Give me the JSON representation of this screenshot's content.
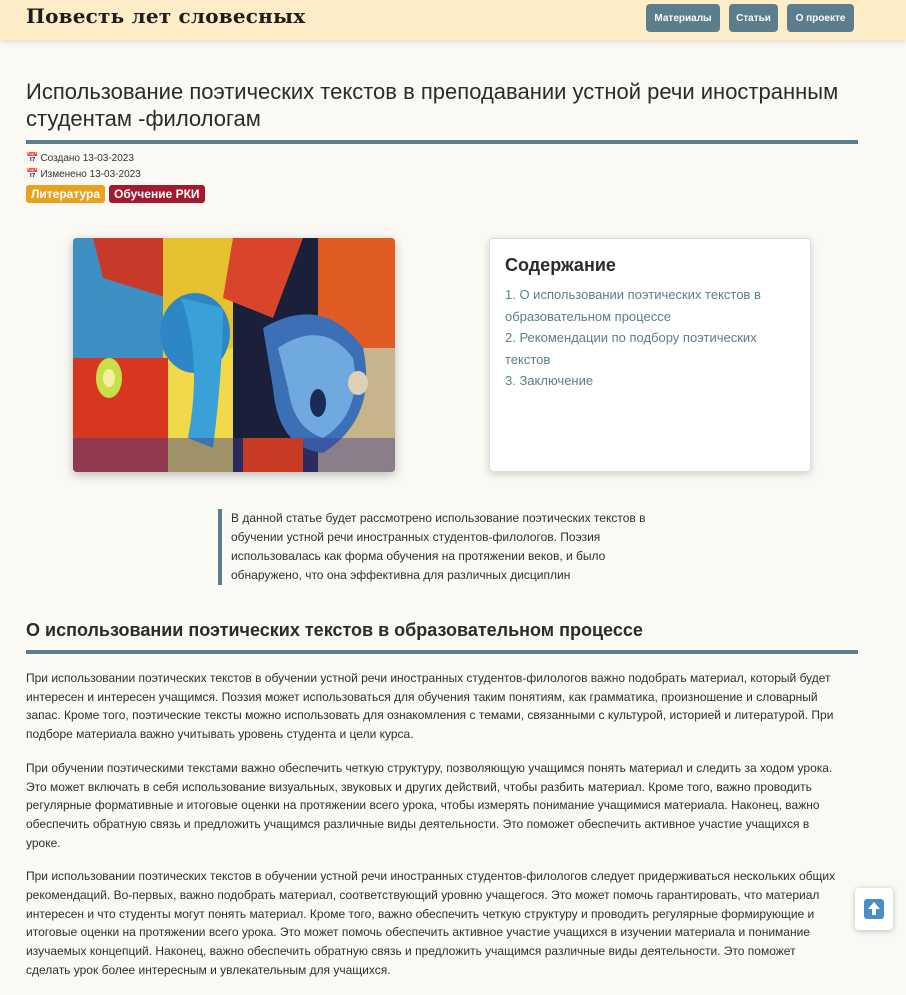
{
  "navbar": {
    "brand": "Повесть лет словесных",
    "items": [
      {
        "label": "Материалы"
      },
      {
        "label": "Статьи"
      },
      {
        "label": "О проекте"
      }
    ]
  },
  "article": {
    "title": "Использование поэтических текстов в преподавании устной речи иностранным студентам -филологам",
    "created": "Создано 13-03-2023",
    "modified": "Изменено 13-03-2023",
    "tags": [
      {
        "label": "Литература",
        "color": "#e8a21d"
      },
      {
        "label": "Обучение РКИ",
        "color": "#a3192e"
      }
    ],
    "lead": "В данной статье будет рассмотрено использование поэтических текстов в обучении устной речи иностранных студентов-филологов. Поэзия использовалась как форма обучения на протяжении веков, и было обнаружено, что она эффективна для различных дисциплин"
  },
  "toc": {
    "title": "Содержание",
    "items": [
      {
        "label": "1. О использовании поэтических текстов в образовательном процессе"
      },
      {
        "label": "2. Рекомендации по подбору поэтических текстов"
      },
      {
        "label": "3. Заключение"
      }
    ]
  },
  "section1": {
    "title": "О использовании поэтических текстов в образовательном процессе",
    "paragraphs": [
      "При использовании поэтических текстов в обучении устной речи иностранных студентов-филологов важно подобрать материал, который будет интересен и интересен учащимся. Поэзия может использоваться для обучения таким понятиям, как грамматика, произношение и словарный запас. Кроме того, поэтические тексты можно использовать для ознакомления с темами, связанными с культурой, историей и литературой. При подборе материала важно учитывать уровень студента и цели курса.",
      "При обучении поэтическими текстами важно обеспечить четкую структуру, позволяющую учащимся понять материал и следить за ходом урока. Это может включать в себя использование визуальных, звуковых и других действий, чтобы разбить материал. Кроме того, важно проводить регулярные формативные и итоговые оценки на протяжении всего урока, чтобы измерять понимание учащимися материала. Наконец, важно обеспечить обратную связь и предложить учащимся различные виды деятельности. Это поможет обеспечить активное участие учащихся в уроке.",
      "При использовании поэтических текстов в обучении устной речи иностранных студентов-филологов следует придерживаться нескольких общих рекомендаций. Во-первых, важно подобрать материал, соответствующий уровню учащегося. Это может помочь гарантировать, что материал интересен и что студенты могут понять материал. Кроме того, важно обеспечить четкую структуру и проводить регулярные формирующие и итоговые оценки на протяжении всего урока. Это может помочь обеспечить активное участие учащихся в изучении материала и понимание изучаемых концепций. Наконец, важно обеспечить обратную связь и предложить учащимся различные виды деятельности. Это поможет сделать урок более интересным и увлекательным для учащихся."
    ]
  },
  "colors": {
    "accent": "#5b7d8c",
    "navbar_bg": "#fdecc8",
    "page_bg": "#fbf9f4"
  },
  "icons": {
    "calendar": "calendar-icon",
    "scroll_top": "arrow-up-icon"
  }
}
